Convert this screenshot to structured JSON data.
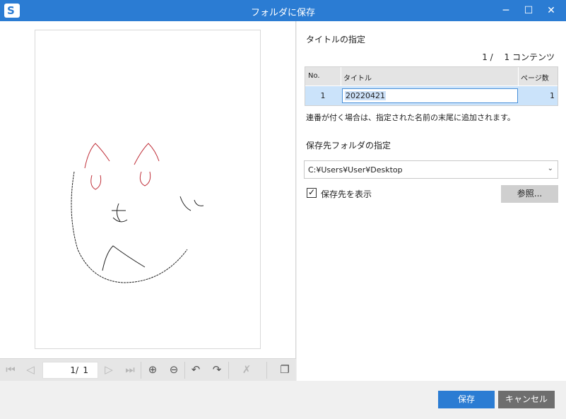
{
  "window": {
    "title": "フォルダに保存",
    "logo_letter": "S",
    "minimize_icon": "─",
    "maximize_icon": "☐",
    "close_icon": "✕"
  },
  "toolbar": {
    "current_page": "1",
    "separator": "/",
    "total_pages": "1",
    "icons": [
      "first-page-icon",
      "prev-page-icon",
      "next-page-icon",
      "last-page-icon",
      "zoom-in-icon",
      "zoom-out-icon",
      "rotate-left-icon",
      "rotate-right-icon",
      "delete-page-icon",
      "copy-pages-icon"
    ]
  },
  "title_section": {
    "label": "タイトルの指定",
    "count": "1 /　 1 コンテンツ",
    "columns": [
      "No.",
      "タイトル",
      "ページ数"
    ],
    "rows": [
      {
        "no": "1",
        "title": "20220421",
        "pages": "1"
      }
    ],
    "note": "連番が付く場合は、指定された名前の末尾に追加されます。"
  },
  "folder_section": {
    "label": "保存先フォルダの指定",
    "path": "C:¥Users¥User¥Desktop",
    "show_folder_label": "保存先を表示",
    "show_folder_checked": true,
    "browse_label": "参照..."
  },
  "footer": {
    "save_label": "保存",
    "cancel_label": "キャンセル"
  },
  "colors": {
    "accent": "#2b7cd3",
    "selection": "#cbe3fa"
  }
}
